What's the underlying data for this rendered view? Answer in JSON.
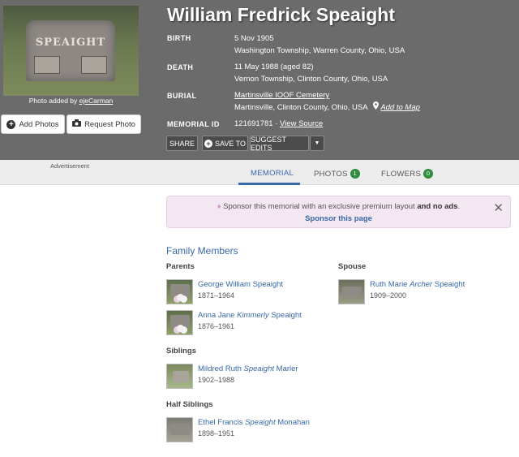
{
  "memorial": {
    "name": "William Fredrick Speaight",
    "photo_credit_prefix": "Photo added by",
    "photo_credit_user": "ejeCarman",
    "headstone_text": "SPEAIGHT",
    "add_photos_label": "Add Photos",
    "request_photo_label": "Request Photo",
    "birth_label": "BIRTH",
    "birth_date": "5 Nov 1905",
    "birth_place": "Washington Township, Warren County, Ohio, USA",
    "death_label": "DEATH",
    "death_date": "11 May 1988 (aged 82)",
    "death_place": "Vernon Township, Clinton County, Ohio, USA",
    "burial_label": "BURIAL",
    "burial_cemetery": "Martinsville IOOF Cemetery",
    "burial_place": "Martinsville, Clinton County, Ohio, USA",
    "add_to_map_label": "Add to Map",
    "memorial_id_label": "MEMORIAL ID",
    "memorial_id": "121691781",
    "view_source_label": "View Source",
    "share_label": "SHARE",
    "save_to_label": "SAVE TO",
    "suggest_edits_label": "SUGGEST EDITS"
  },
  "tabs": {
    "advertisement": "Advertisement",
    "memorial": "MEMORIAL",
    "photos": "PHOTOS",
    "photos_count": "1",
    "flowers": "FLOWERS",
    "flowers_count": "0"
  },
  "sponsor": {
    "text": "Sponsor this memorial with an exclusive premium layout",
    "text_bold": "and no ads",
    "link": "Sponsor this page"
  },
  "family": {
    "title": "Family Members",
    "parents_label": "Parents",
    "spouse_label": "Spouse",
    "siblings_label": "Siblings",
    "half_siblings_label": "Half Siblings",
    "parents": [
      {
        "first": "George William Speaight",
        "maiden": "",
        "last": "",
        "dates": "1871–1964"
      },
      {
        "first": "Anna Jane",
        "maiden": "Kimmerly",
        "last": "Speaight",
        "dates": "1876–1961"
      }
    ],
    "spouse": [
      {
        "first": "Ruth Marie",
        "maiden": "Archer",
        "last": "Speaight",
        "dates": "1909–2000"
      }
    ],
    "siblings": [
      {
        "first": "Mildred Ruth",
        "maiden": "Speaight",
        "last": "Marler",
        "dates": "1902–1988"
      }
    ],
    "half_siblings": [
      {
        "first": "Ethel Francis",
        "maiden": "Speaight",
        "last": "Monahan",
        "dates": "1898–1951"
      }
    ]
  },
  "colors": {
    "header_bg": "#6b6b6b",
    "link": "#3868a8",
    "badge": "#2e8b3f",
    "sponsor_bg": "#f3e7f2"
  }
}
